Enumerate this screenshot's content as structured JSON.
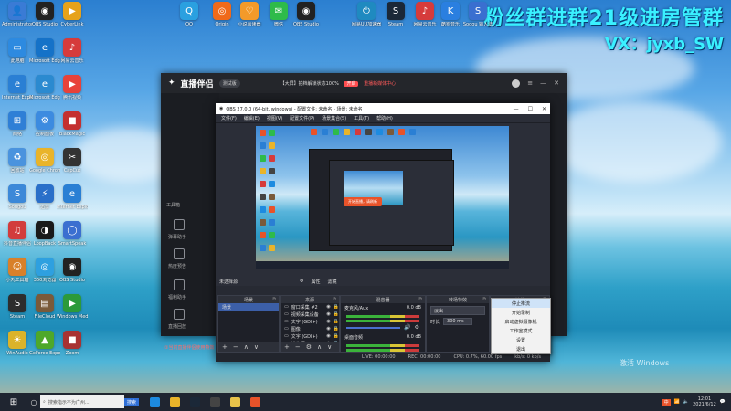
{
  "watermark": {
    "line1": "粉丝群进群21级进房管群",
    "line2": "VX：jyxb_SW"
  },
  "desktop_icons": [
    {
      "label": "Administrator",
      "color": "#3a7bd5",
      "glyph": "👤"
    },
    {
      "label": "OBS Studio",
      "color": "#222222",
      "glyph": "◉"
    },
    {
      "label": "CyberLink",
      "color": "#e6a21a",
      "glyph": "▶"
    },
    {
      "label": "此电脑",
      "color": "#2d8ae0",
      "glyph": "▭"
    },
    {
      "label": "Microsoft Edge",
      "color": "#1572c8",
      "glyph": "e"
    },
    {
      "label": "网易云音乐",
      "color": "#d63b3b",
      "glyph": "♪"
    },
    {
      "label": "Internet Explorer",
      "color": "#2a7fd4",
      "glyph": "e"
    },
    {
      "label": "Microsoft Edge",
      "color": "#2b8ad0",
      "glyph": "e"
    },
    {
      "label": "腾讯视频",
      "color": "#e8423a",
      "glyph": "▶"
    },
    {
      "label": "网络",
      "color": "#2f7fd6",
      "glyph": "⊞"
    },
    {
      "label": "控制面板",
      "color": "#3c8be0",
      "glyph": "⚙"
    },
    {
      "label": "BlackMagic",
      "color": "#c43030",
      "glyph": "■"
    },
    {
      "label": "回收站",
      "color": "#4a93de",
      "glyph": "♻"
    },
    {
      "label": "Google Chrome",
      "color": "#e9b42a",
      "glyph": "◎"
    },
    {
      "label": "CapCut",
      "color": "#333333",
      "glyph": "✂"
    },
    {
      "label": "Sougou",
      "color": "#3c88d8",
      "glyph": "S"
    },
    {
      "label": "迅雷",
      "color": "#2a6fc9",
      "glyph": "⚡"
    },
    {
      "label": "Internet Explorer",
      "color": "#2a7fd4",
      "glyph": "e"
    },
    {
      "label": "抖音直播伴侣",
      "color": "#d23c3c",
      "glyph": "♫"
    },
    {
      "label": "LoopBack",
      "color": "#1a1a1a",
      "glyph": "◑"
    },
    {
      "label": "SmartSpeak",
      "color": "#3b6fd0",
      "glyph": "◯"
    },
    {
      "label": "小丸工具箱",
      "color": "#d8802a",
      "glyph": "☺"
    },
    {
      "label": "360浏览器",
      "color": "#2ea0e0",
      "glyph": "◎"
    },
    {
      "label": "OBS Studio",
      "color": "#222222",
      "glyph": "◉"
    },
    {
      "label": "Steam",
      "color": "#2d2d2d",
      "glyph": "S"
    },
    {
      "label": "FileCloud",
      "color": "#7a5a3a",
      "glyph": "▤"
    },
    {
      "label": "Windows Media",
      "color": "#2c9a3a",
      "glyph": "▶"
    },
    {
      "label": "WinAudio",
      "color": "#dbb32a",
      "glyph": "☀"
    },
    {
      "label": "GeForce Experience",
      "color": "#4ea82a",
      "glyph": "▲"
    },
    {
      "label": "Zoom",
      "color": "#a83232",
      "glyph": "■"
    }
  ],
  "top_icons": [
    {
      "label": "QQ",
      "color": "#2aa0e0",
      "glyph": "Q"
    },
    {
      "label": "Origin",
      "color": "#f06a1a",
      "glyph": "◎"
    },
    {
      "label": "小说阅读器",
      "color": "#f39a2a",
      "glyph": "♡"
    },
    {
      "label": "微信",
      "color": "#2ebb4a",
      "glyph": "✉"
    },
    {
      "label": "OBS Studio",
      "color": "#222222",
      "glyph": "◉"
    },
    {
      "label": "网易UU加速器",
      "color": "#1f8ac0",
      "glyph": "⏻"
    },
    {
      "label": "Steam",
      "color": "#1b2838",
      "glyph": "S"
    },
    {
      "label": "网易云音乐",
      "color": "#d63b3b",
      "glyph": "♪"
    },
    {
      "label": "酷狗音乐",
      "color": "#2a7fe0",
      "glyph": "K"
    },
    {
      "label": "Sogou 输入法",
      "color": "#3a6fd0",
      "glyph": "S"
    }
  ],
  "zhibo": {
    "logo": "直播伴侣",
    "version": "测试版",
    "status_text": "【大屏】拍档解锁状态100%",
    "status_tag": "开启",
    "status_extra": "重播新媒体中心",
    "side_items": [
      "工具箱",
      "弹幕助手",
      "热度预告",
      "福利助手",
      "直播回放",
      "更多"
    ],
    "bottom_note": "①当前直播伴侣使用特效"
  },
  "obs": {
    "title": "OBS 27.0.0 (64-bit, windows) - 配置文件: 未命名 - 场景: 未命名",
    "menu": [
      "文件(F)",
      "编辑(E)",
      "视图(V)",
      "配置文件(P)",
      "场景集合(S)",
      "工具(T)",
      "帮助(H)"
    ],
    "no_source": "未选择源",
    "props_label": "属性",
    "filter_label": "滤镜",
    "docks": {
      "scenes": {
        "title": "场景",
        "items": [
          "场景"
        ]
      },
      "sources": {
        "title": "来源",
        "items": [
          "窗口采集 #2",
          "视频采集设备",
          "文字 (GDI+)",
          "图像",
          "文字 (GDI+)",
          "媒体源"
        ]
      },
      "mixer": {
        "title": "混音器",
        "tracks": [
          {
            "name": "麦克风/Aux",
            "db": "0.0 dB"
          },
          {
            "name": "桌面音频",
            "db": "0.0 dB"
          }
        ]
      },
      "transitions": {
        "title": "转场特效",
        "type": "淡出",
        "duration_label": "时长",
        "duration": "300 ms"
      },
      "controls": {
        "title": "控件",
        "buttons": [
          "停止推流",
          "开始录制",
          "启动虚拟摄像机",
          "工作室模式",
          "设置",
          "退出"
        ]
      }
    },
    "status": {
      "live": "LIVE: 00:00:00",
      "rec": "REC: 00:00:00",
      "cpu": "CPU: 0.7%, 60.00 fps",
      "kbps": "kb/s: 0 kb/s"
    },
    "preview_button": "开始直播，请刷新"
  },
  "taskbar": {
    "search_placeholder": "搜索指示不为广州...",
    "search_btn": "搜索",
    "time": "12:01",
    "date": "2021/6/12",
    "ime": "中",
    "apps": [
      {
        "name": "edge",
        "color": "#1d8be0"
      },
      {
        "name": "chrome",
        "color": "#e9b42a"
      },
      {
        "name": "steam",
        "color": "#1b2838"
      },
      {
        "name": "obs",
        "color": "#444444"
      },
      {
        "name": "folder",
        "color": "#e7c24a"
      },
      {
        "name": "zhibo",
        "color": "#e8532a"
      }
    ]
  },
  "activate_windows": "激活 Windows"
}
